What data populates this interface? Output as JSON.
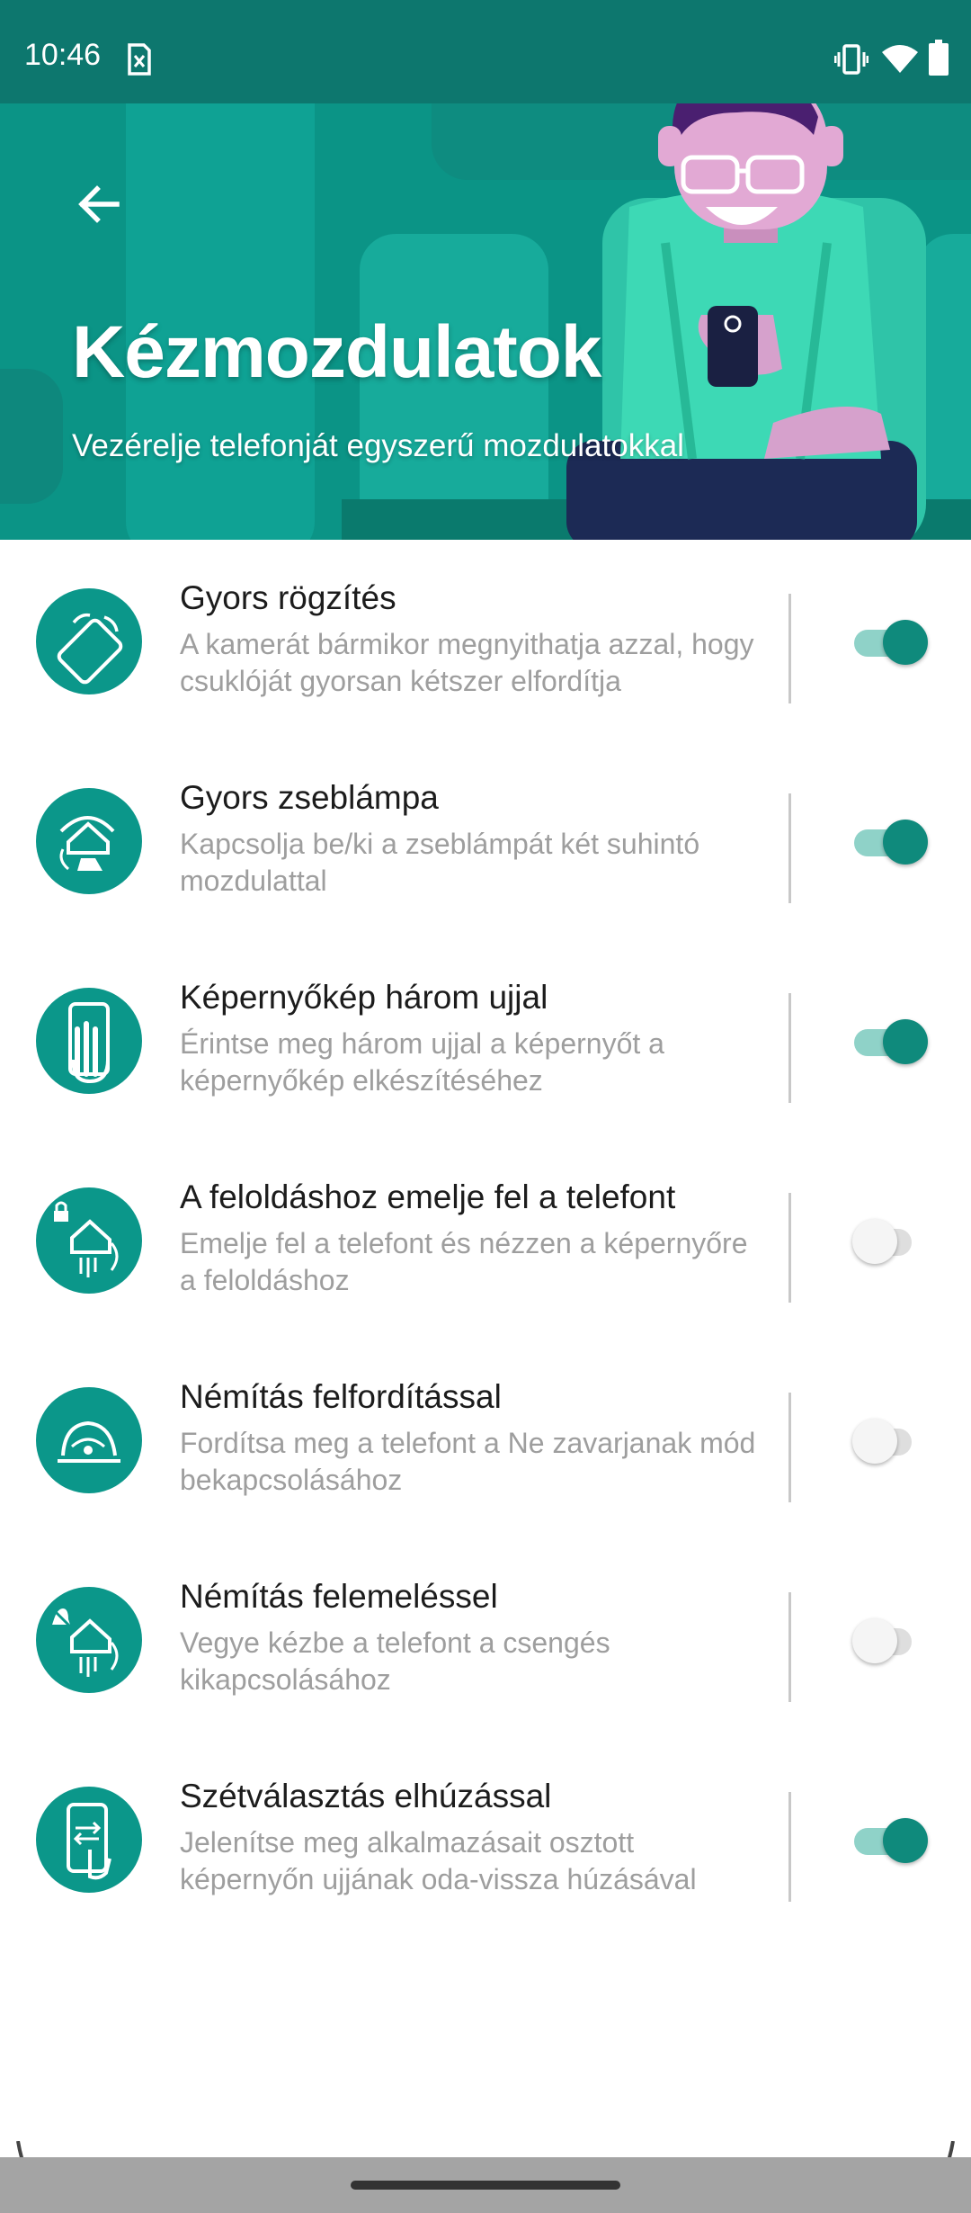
{
  "status_bar": {
    "time": "10:46",
    "notification_icon": "sim-card-alert-icon",
    "right_icons": [
      "vibrate-icon",
      "wifi-icon",
      "battery-icon"
    ]
  },
  "header": {
    "back_icon": "arrow-back-icon",
    "title": "Kézmozdulatok",
    "subtitle": "Vezérelje telefonját egyszerű mozdulatokkal",
    "colors": {
      "background": "#0b9486",
      "status_bar": "#0d776e"
    }
  },
  "gestures": [
    {
      "icon": "quick-capture-icon",
      "title": "Gyors rögzítés",
      "description": "A kamerát bármikor megnyithatja azzal, hogy csuklóját gyorsan kétszer elfordítja",
      "enabled": true
    },
    {
      "icon": "flashlight-chop-icon",
      "title": "Gyors zseblámpa",
      "description": "Kapcsolja be/ki a zseblámpát két suhintó mozdulattal",
      "enabled": true
    },
    {
      "icon": "three-finger-screenshot-icon",
      "title": "Képernyőkép három ujjal",
      "description": "Érintse meg három ujjal a képernyőt a képernyőkép elkészítéséhez",
      "enabled": true
    },
    {
      "icon": "lift-to-unlock-icon",
      "title": "A feloldáshoz emelje fel a telefont",
      "description": "Emelje fel a telefont és nézzen a képernyőre a feloldáshoz",
      "enabled": false
    },
    {
      "icon": "flip-to-silence-icon",
      "title": "Némítás felfordítással",
      "description": "Fordítsa meg a telefont a Ne zavarjanak mód bekapcsolásához",
      "enabled": false
    },
    {
      "icon": "lift-to-silence-icon",
      "title": "Némítás felemeléssel",
      "description": "Vegye kézbe a telefont a csengés kikapcsolásához",
      "enabled": false
    },
    {
      "icon": "swipe-to-split-icon",
      "title": "Szétválasztás elhúzással",
      "description": "Jelenítse meg alkalmazásait osztott képernyőn ujjának oda-vissza húzásával",
      "enabled": true
    }
  ],
  "colors": {
    "accent": "#0f8a7c",
    "icon_circle": "#0b978a"
  }
}
